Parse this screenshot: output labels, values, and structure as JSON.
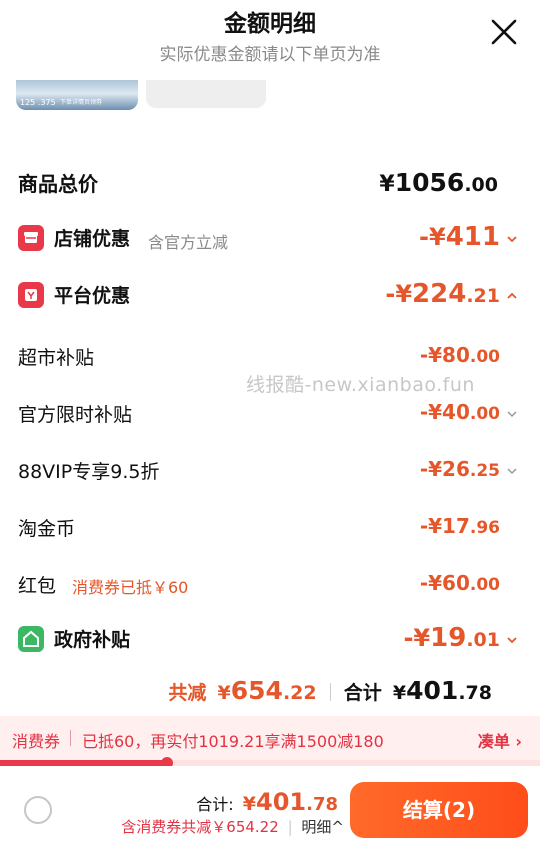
{
  "header": {
    "title": "金额明细",
    "subtitle": "实际优惠金额请以下单页为准"
  },
  "thumbnail": {
    "numbers": "125 .375",
    "caption": "下单详情页领券"
  },
  "goods_total": {
    "label": "商品总价",
    "currency": "¥",
    "amount_int": "1056",
    "amount_dec": ".00"
  },
  "store_discount": {
    "label": "店铺优惠",
    "note": "含官方立减",
    "prefix": "-¥",
    "amount_int": "411",
    "amount_dec": ""
  },
  "platform_discount": {
    "label": "平台优惠",
    "prefix": "-¥",
    "amount_int": "224",
    "amount_dec": ".21"
  },
  "sub_items": [
    {
      "label": "超市补贴",
      "note": "",
      "prefix": "-¥",
      "amount_int": "80",
      "amount_dec": ".00",
      "has_chevron": false
    },
    {
      "label": "官方限时补贴",
      "note": "",
      "prefix": "-¥",
      "amount_int": "40",
      "amount_dec": ".00",
      "has_chevron": true
    },
    {
      "label": "88VIP专享9.5折",
      "note": "",
      "prefix": "-¥",
      "amount_int": "26",
      "amount_dec": ".25",
      "has_chevron": true
    },
    {
      "label": "淘金币",
      "note": "",
      "prefix": "-¥",
      "amount_int": "17",
      "amount_dec": ".96",
      "has_chevron": false
    },
    {
      "label": "红包",
      "note": "消费券已抵￥60",
      "prefix": "-¥",
      "amount_int": "60",
      "amount_dec": ".00",
      "has_chevron": false
    }
  ],
  "gov_subsidy": {
    "label": "政府补贴",
    "prefix": "-¥",
    "amount_int": "19",
    "amount_dec": ".01"
  },
  "watermark": "线报酷-new.xianbao.fun",
  "summary": {
    "reduced_label": "共减",
    "reduced_currency": "¥",
    "reduced_int": "654",
    "reduced_dec": ".22",
    "total_label": "合计",
    "total_currency": "¥",
    "total_int": "401",
    "total_dec": ".78"
  },
  "coupon_bar": {
    "label": "消费券",
    "text": "已抵60，再实付1019.21享满1500减180",
    "link": "凑单",
    "progress": 0.31
  },
  "footer": {
    "total_label": "合计:",
    "total_currency": "¥",
    "total_int": "401",
    "total_dec": ".78",
    "detail": "含消费券共减￥654.22",
    "detail_link": "明细",
    "checkout_label": "结算(2)"
  },
  "colors": {
    "accent": "#e5572b",
    "red": "#e8384a",
    "green": "#3cb864",
    "checkout": "#ff5722"
  }
}
